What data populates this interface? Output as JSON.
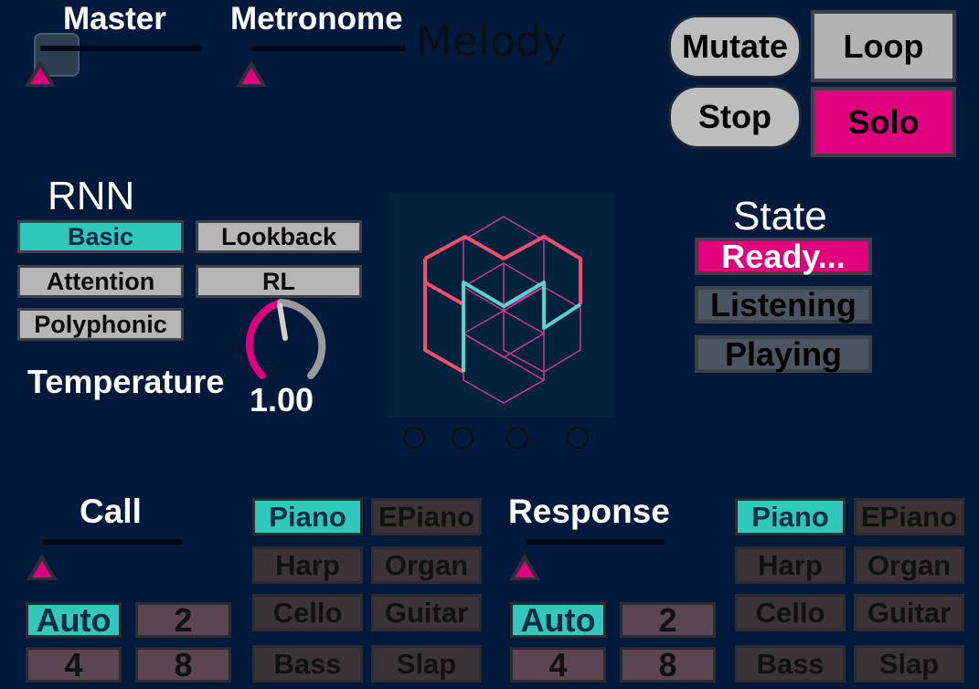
{
  "colors": {
    "background": "#011a3c",
    "accent_pink": "#e0007e",
    "accent_teal": "#30c8bd",
    "button_gray": "#b6b6b6"
  },
  "header": {
    "master_label": "Master",
    "metronome_label": "Metronome",
    "melody_label": "Melody"
  },
  "transport": {
    "mutate": "Mutate",
    "stop": "Stop",
    "loop": "Loop",
    "solo": "Solo"
  },
  "rnn": {
    "title": "RNN",
    "modes": [
      {
        "label": "Basic",
        "selected": true
      },
      {
        "label": "Lookback",
        "selected": false
      },
      {
        "label": "Attention",
        "selected": false
      },
      {
        "label": "RL",
        "selected": false
      },
      {
        "label": "Polyphonic",
        "selected": false
      }
    ],
    "temperature_label": "Temperature",
    "temperature_value": "1.00"
  },
  "state": {
    "title": "State",
    "items": [
      {
        "label": "Ready...",
        "active": true
      },
      {
        "label": "Listening",
        "active": false
      },
      {
        "label": "Playing",
        "active": false
      }
    ]
  },
  "logo": {
    "icon": "magenta-hexagon-logo-icon"
  },
  "call": {
    "title": "Call",
    "lengths": [
      {
        "label": "Auto",
        "selected": true
      },
      {
        "label": "2",
        "selected": false
      },
      {
        "label": "4",
        "selected": false
      },
      {
        "label": "8",
        "selected": false
      }
    ],
    "instruments": [
      {
        "label": "Piano",
        "selected": true
      },
      {
        "label": "EPiano",
        "selected": false
      },
      {
        "label": "Harp",
        "selected": false
      },
      {
        "label": "Organ",
        "selected": false
      },
      {
        "label": "Cello",
        "selected": false
      },
      {
        "label": "Guitar",
        "selected": false
      },
      {
        "label": "Bass",
        "selected": false
      },
      {
        "label": "Slap",
        "selected": false
      }
    ]
  },
  "response": {
    "title": "Response",
    "lengths": [
      {
        "label": "Auto",
        "selected": true
      },
      {
        "label": "2",
        "selected": false
      },
      {
        "label": "4",
        "selected": false
      },
      {
        "label": "8",
        "selected": false
      }
    ],
    "instruments": [
      {
        "label": "Piano",
        "selected": true
      },
      {
        "label": "EPiano",
        "selected": false
      },
      {
        "label": "Harp",
        "selected": false
      },
      {
        "label": "Organ",
        "selected": false
      },
      {
        "label": "Cello",
        "selected": false
      },
      {
        "label": "Guitar",
        "selected": false
      },
      {
        "label": "Bass",
        "selected": false
      },
      {
        "label": "Slap",
        "selected": false
      }
    ]
  }
}
